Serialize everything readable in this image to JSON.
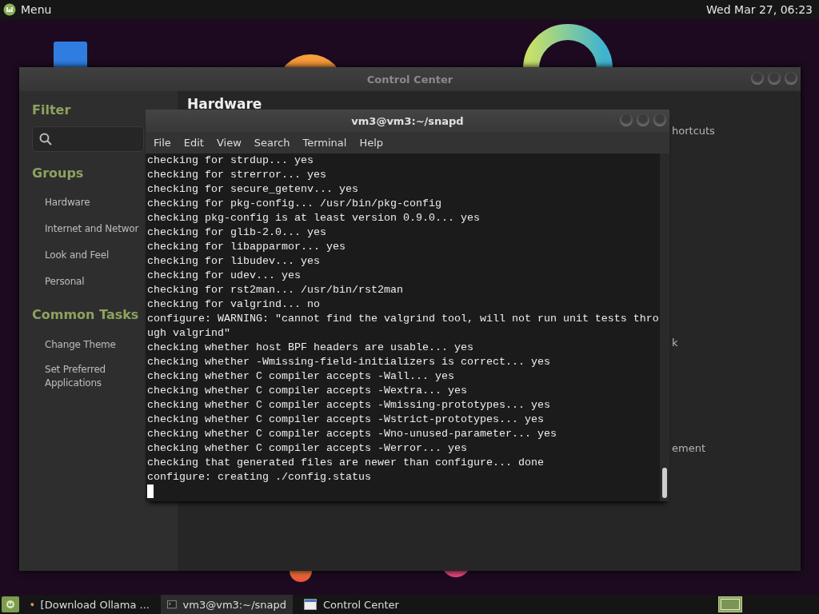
{
  "top_panel": {
    "menu_label": "Menu",
    "clock": "Wed Mar 27, 06:23"
  },
  "control_center": {
    "title": "Control Center",
    "filter_heading": "Filter",
    "groups_heading": "Groups",
    "groups": [
      "Hardware",
      "Internet and Networ",
      "Look and Feel",
      "Personal"
    ],
    "tasks_heading": "Common Tasks",
    "tasks": [
      "Change Theme",
      "Set Preferred Applications"
    ],
    "section_heading": "Hardware",
    "item_fragments": [
      "hortcuts",
      "k",
      "ement"
    ]
  },
  "terminal": {
    "title": "vm3@vm3:~/snapd",
    "menu": [
      "File",
      "Edit",
      "View",
      "Search",
      "Terminal",
      "Help"
    ],
    "lines": [
      "checking for strdup... yes",
      "checking for strerror... yes",
      "checking for secure_getenv... yes",
      "checking for pkg-config... /usr/bin/pkg-config",
      "checking pkg-config is at least version 0.9.0... yes",
      "checking for glib-2.0... yes",
      "checking for libapparmor... yes",
      "checking for libudev... yes",
      "checking for udev... yes",
      "checking for rst2man... /usr/bin/rst2man",
      "checking for valgrind... no",
      "configure: WARNING: \"cannot find the valgrind tool, will not run unit tests thro",
      "ugh valgrind\"",
      "checking whether host BPF headers are usable... yes",
      "checking whether -Wmissing-field-initializers is correct... yes",
      "checking whether C compiler accepts -Wall... yes",
      "checking whether C compiler accepts -Wextra... yes",
      "checking whether C compiler accepts -Wmissing-prototypes... yes",
      "checking whether C compiler accepts -Wstrict-prototypes... yes",
      "checking whether C compiler accepts -Wno-unused-parameter... yes",
      "checking whether C compiler accepts -Werror... yes",
      "checking that generated files are newer than configure... done",
      "configure: creating ./config.status"
    ]
  },
  "taskbar": {
    "tasks": [
      {
        "kind": "browser",
        "label": "[Download Ollama ...",
        "selected": false
      },
      {
        "kind": "terminal",
        "label": "vm3@vm3:~/snapd",
        "selected": true
      },
      {
        "kind": "window",
        "label": "Control Center",
        "selected": false
      }
    ]
  }
}
